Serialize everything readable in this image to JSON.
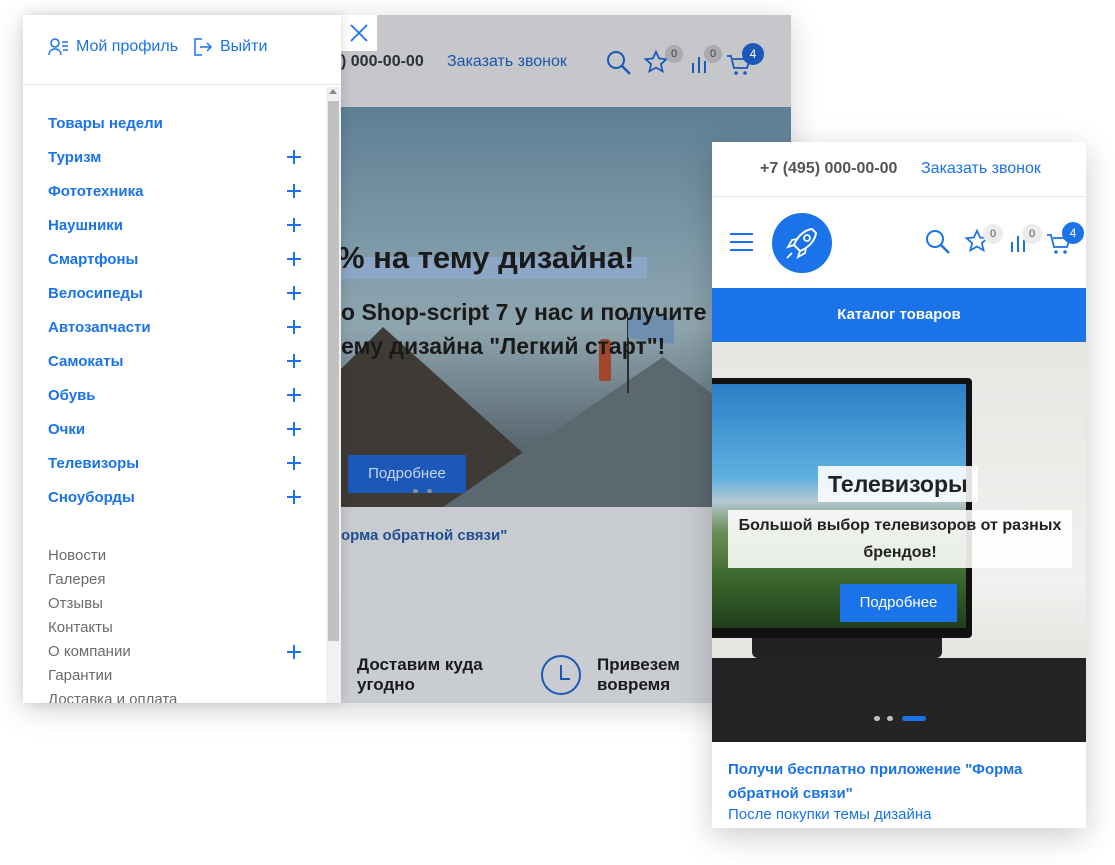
{
  "colors": {
    "accent": "#1a73e8",
    "badge_grey": "#ececec",
    "text_grey": "#6b6b6b"
  },
  "back_site": {
    "phone": ") 000-00-00",
    "callback": "Заказать звонок",
    "wishlist_count": "0",
    "compare_count": "0",
    "cart_count": "4",
    "hero_heading": "% на тему дизайна!",
    "hero_line1": "о Shop-script 7 у нас и получите",
    "hero_line2": "ему дизайна \"Легкий старт\"!",
    "hero_button": "Подробнее",
    "app_link": "орма обратной связи\"",
    "feature1": "Доставим куда угодно",
    "feature2": "Привезем вовремя"
  },
  "drawer": {
    "profile": "Мой профиль",
    "logout": "Выйти",
    "categories": [
      {
        "label": "Товары недели",
        "expandable": false
      },
      {
        "label": "Туризм",
        "expandable": true
      },
      {
        "label": "Фототехника",
        "expandable": true
      },
      {
        "label": "Наушники",
        "expandable": true
      },
      {
        "label": "Смартфоны",
        "expandable": true
      },
      {
        "label": "Велосипеды",
        "expandable": true
      },
      {
        "label": "Автозапчасти",
        "expandable": true
      },
      {
        "label": "Самокаты",
        "expandable": true
      },
      {
        "label": "Обувь",
        "expandable": true
      },
      {
        "label": "Очки",
        "expandable": true
      },
      {
        "label": "Телевизоры",
        "expandable": true
      },
      {
        "label": "Сноуборды",
        "expandable": true
      }
    ],
    "info_links": [
      {
        "label": "Новости",
        "expandable": false
      },
      {
        "label": "Галерея",
        "expandable": false
      },
      {
        "label": "Отзывы",
        "expandable": false
      },
      {
        "label": "Контакты",
        "expandable": false
      },
      {
        "label": "О компании",
        "expandable": true
      },
      {
        "label": "Гарантии",
        "expandable": false
      },
      {
        "label": "Доставка и оплата",
        "expandable": false
      }
    ]
  },
  "mobile": {
    "phone": "+7 (495) 000-00-00",
    "callback": "Заказать звонок",
    "wishlist_count": "0",
    "compare_count": "0",
    "cart_count": "4",
    "catalog_button": "Каталог товаров",
    "slide_title": "Телевизоры",
    "slide_text": "Большой выбор телевизоров от разных брендов!",
    "slide_button": "Подробнее",
    "slide_count": 3,
    "active_slide": 3,
    "app_link": "Получи бесплатно приложение \"Форма обратной связи\"",
    "app_subtext": "После покупки темы дизайна"
  }
}
